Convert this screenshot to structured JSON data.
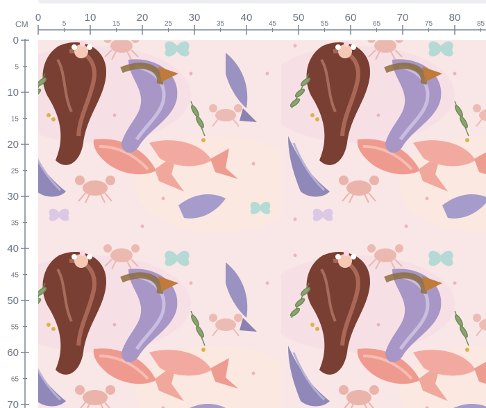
{
  "ruler": {
    "unit": "CM",
    "top_major": [
      "0",
      "10",
      "20",
      "30",
      "40",
      "50",
      "60",
      "70",
      "80"
    ],
    "top_minor": [
      "5",
      "15",
      "25",
      "35",
      "45",
      "55",
      "65",
      "75",
      "85"
    ],
    "left_major": [
      "0",
      "10",
      "20",
      "30",
      "40",
      "50",
      "60",
      "70"
    ],
    "left_minor": [
      "5",
      "15",
      "25",
      "35",
      "45",
      "55",
      "65"
    ]
  },
  "fabric": {
    "pattern_name": "mermaid-watercolor-print",
    "motifs": [
      "mermaid",
      "mermaid-tail",
      "crab",
      "butterfly",
      "leaf-sprig",
      "dot"
    ],
    "colors": {
      "background": "#f9e6e6",
      "hair_brown": "#7a3f33",
      "hair_lavender": "#a796c6",
      "tail_coral": "#ef9a8e",
      "tail_lavender": "#8f88b8",
      "crab_pink": "#eab4aa",
      "leaf_green": "#8aa36f",
      "butterfly_aqua": "#a9d8d3",
      "ruler_line": "#7c8591"
    }
  }
}
